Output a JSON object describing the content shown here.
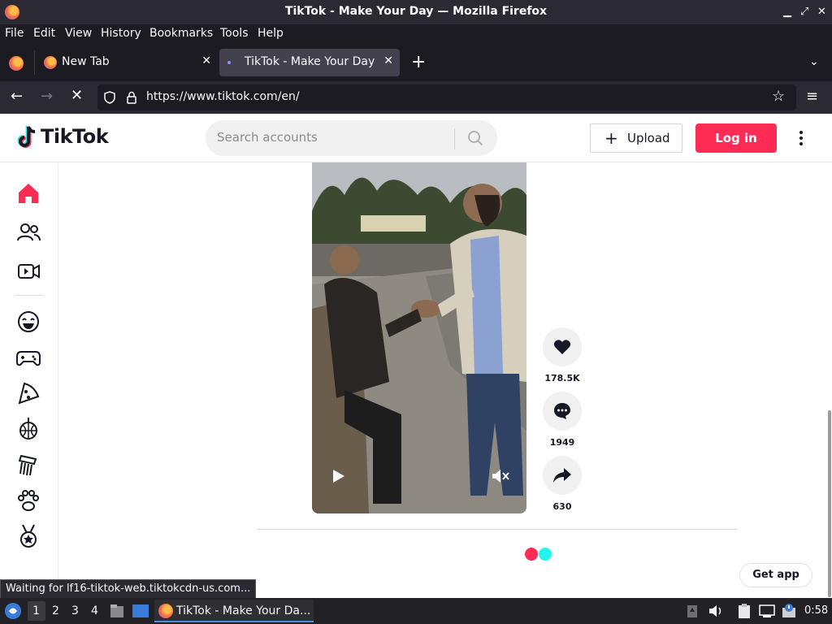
{
  "window": {
    "title": "TikTok - Make Your Day — Mozilla Firefox"
  },
  "menu": [
    "File",
    "Edit",
    "View",
    "History",
    "Bookmarks",
    "Tools",
    "Help"
  ],
  "tabs": [
    {
      "label": "New Tab",
      "active": false
    },
    {
      "label": "TikTok - Make Your Day",
      "active": true
    }
  ],
  "navbar": {
    "url": "https://www.tiktok.com/en/"
  },
  "tiktok": {
    "logo": "TikTok",
    "search_placeholder": "Search accounts",
    "upload_label": "Upload",
    "login_label": "Log in",
    "likes": "178.5K",
    "comments": "1949",
    "shares": "630",
    "get_app": "Get app"
  },
  "status_message": "Waiting for lf16-tiktok-web.tiktokcdn-us.com...",
  "taskbar": {
    "workspaces": [
      "1",
      "2",
      "3",
      "4"
    ],
    "window_label": "TikTok - Make Your Da...",
    "clock": "0:58"
  },
  "colors": {
    "accent": "#fe2c55",
    "cyan": "#25f4ee"
  }
}
